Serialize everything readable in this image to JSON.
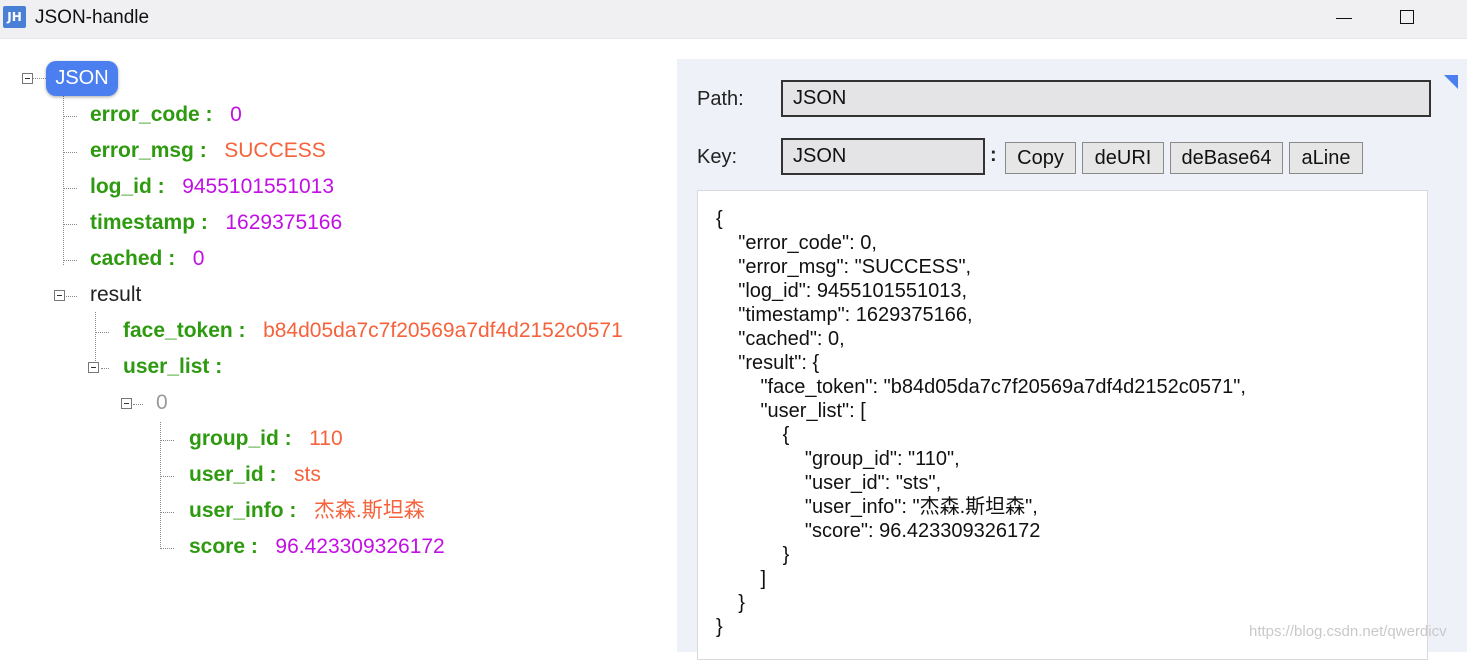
{
  "window": {
    "icon_text": "JH",
    "title": "JSON-handle"
  },
  "tree": {
    "root_label": "JSON",
    "nodes": [
      {
        "key": "error_code",
        "sep": " :",
        "value": "0",
        "type": "num"
      },
      {
        "key": "error_msg",
        "sep": " :",
        "value": "SUCCESS",
        "type": "str"
      },
      {
        "key": "log_id",
        "sep": " :",
        "value": "9455101551013",
        "type": "num"
      },
      {
        "key": "timestamp",
        "sep": " :",
        "value": "1629375166",
        "type": "num"
      },
      {
        "key": "cached",
        "sep": " :",
        "value": "0",
        "type": "num"
      }
    ],
    "result_label": "result",
    "face_token": {
      "key": "face_token",
      "sep": " :",
      "value": "b84d05da7c7f20569a7df4d2152c0571"
    },
    "user_list_label": "user_list :",
    "index_label": "0",
    "user_nodes": [
      {
        "key": "group_id",
        "sep": " :",
        "value": "110",
        "type": "str"
      },
      {
        "key": "user_id",
        "sep": " :",
        "value": "sts",
        "type": "str"
      },
      {
        "key": "user_info",
        "sep": " :",
        "value": "杰森.斯坦森",
        "type": "str"
      },
      {
        "key": "score",
        "sep": " :",
        "value": "96.423309326172",
        "type": "num"
      }
    ]
  },
  "panel": {
    "path_label": "Path:",
    "path_value": "JSON",
    "key_label": "Key:",
    "key_value": "JSON",
    "key_colon": ":",
    "buttons": {
      "copy": "Copy",
      "deuri": "deURI",
      "debase64": "deBase64",
      "aline": "aLine"
    },
    "json_text": "{\n    \"error_code\": 0,\n    \"error_msg\": \"SUCCESS\",\n    \"log_id\": 9455101551013,\n    \"timestamp\": 1629375166,\n    \"cached\": 0,\n    \"result\": {\n        \"face_token\": \"b84d05da7c7f20569a7df4d2152c0571\",\n        \"user_list\": [\n            {\n                \"group_id\": \"110\",\n                \"user_id\": \"sts\",\n                \"user_info\": \"杰森.斯坦森\",\n                \"score\": 96.423309326172\n            }\n        ]\n    }\n}"
  },
  "watermark": "https://blog.csdn.net/qwerdicv",
  "colors": {
    "key_green": "#2e9a10",
    "number_magenta": "#c10fe4",
    "string_orange": "#f5623b",
    "root_pill_blue": "#4b7ff0"
  }
}
